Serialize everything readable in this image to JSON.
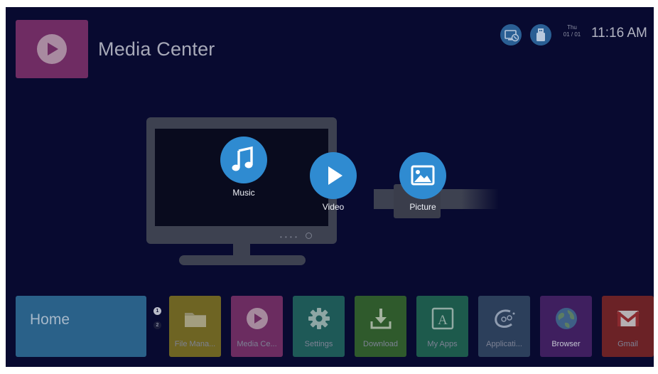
{
  "header": {
    "title": "Media Center",
    "day": "Thu",
    "date": "01 / 01",
    "time": "11:16 AM"
  },
  "media": {
    "items": [
      {
        "label": "Music",
        "icon": "music-note-icon"
      },
      {
        "label": "Video",
        "icon": "play-icon"
      },
      {
        "label": "Picture",
        "icon": "picture-icon"
      }
    ]
  },
  "bottom": {
    "home_label": "Home",
    "pages": [
      "1",
      "2"
    ],
    "apps": [
      {
        "label": "File Mana...",
        "icon": "folder-icon",
        "color": "#6e6423"
      },
      {
        "label": "Media Ce...",
        "icon": "media-center-icon",
        "color": "#6b2c60"
      },
      {
        "label": "Settings",
        "icon": "gear-icon",
        "color": "#1e5957"
      },
      {
        "label": "Download",
        "icon": "download-icon",
        "color": "#2f5a2c"
      },
      {
        "label": "My Apps",
        "icon": "my-apps-icon",
        "color": "#1d5a4c"
      },
      {
        "label": "Applicati...",
        "icon": "applications-icon",
        "color": "#2c3f5b"
      },
      {
        "label": "Browser",
        "icon": "globe-icon",
        "color": "#3f1f5f"
      },
      {
        "label": "Gmail",
        "icon": "gmail-icon",
        "color": "#6b2226"
      }
    ]
  },
  "colors": {
    "background": "#080a30",
    "accent": "#2f8bd1"
  }
}
